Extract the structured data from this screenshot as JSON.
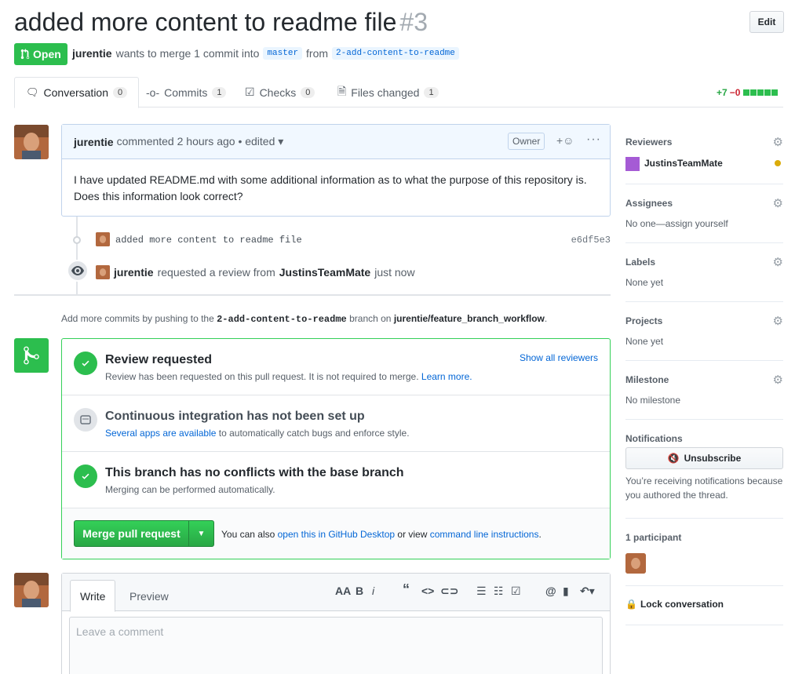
{
  "header": {
    "title": "added more content to readme file",
    "number": "#3",
    "edit_label": "Edit",
    "state": "Open",
    "author": "jurentie",
    "meta_mid": "wants to merge 1 commit into",
    "base_branch": "master",
    "meta_from": "from",
    "head_branch": "2-add-content-to-readme"
  },
  "tabs": [
    {
      "label": "Conversation",
      "count": "0"
    },
    {
      "label": "Commits",
      "count": "1"
    },
    {
      "label": "Checks",
      "count": "0"
    },
    {
      "label": "Files changed",
      "count": "1"
    }
  ],
  "diffstat": {
    "additions": "+7",
    "deletions": "−0"
  },
  "comment": {
    "author": "jurentie",
    "action": "commented 2 hours ago • edited ▾",
    "owner_badge": "Owner",
    "body": "I have updated README.md with some additional information as to what the purpose of this repository is. Does this information look correct?"
  },
  "timeline": {
    "commit_message": "added more content to readme file",
    "commit_sha": "e6df5e3",
    "review_actor": "jurentie",
    "review_text": "requested a review from",
    "review_target": "JustinsTeamMate",
    "review_time": "just now"
  },
  "push_note": {
    "prefix": "Add more commits by pushing to the",
    "branch": "2-add-content-to-readme",
    "mid": "branch on",
    "repo": "jurentie/feature_branch_workflow",
    "suffix": "."
  },
  "merge": {
    "review_title": "Review requested",
    "review_sub": "Review has been requested on this pull request. It is not required to merge.",
    "learn_more": "Learn more.",
    "show_reviewers": "Show all reviewers",
    "ci_title": "Continuous integration has not been set up",
    "ci_link": "Several apps are available",
    "ci_sub": "to automatically catch bugs and enforce style.",
    "conflict_title": "This branch has no conflicts with the base branch",
    "conflict_sub": "Merging can be performed automatically.",
    "merge_button": "Merge pull request",
    "note_prefix": "You can also",
    "note_link1": "open this in GitHub Desktop",
    "note_mid": "or view",
    "note_link2": "command line instructions",
    "note_suffix": "."
  },
  "composer": {
    "tab_write": "Write",
    "tab_preview": "Preview",
    "placeholder": "Leave a comment"
  },
  "sidebar": {
    "reviewers_label": "Reviewers",
    "reviewer_name": "JustinsTeamMate",
    "assignees_label": "Assignees",
    "assignees_value": "No one—assign yourself",
    "labels_label": "Labels",
    "labels_value": "None yet",
    "projects_label": "Projects",
    "projects_value": "None yet",
    "milestone_label": "Milestone",
    "milestone_value": "No milestone",
    "notifications_label": "Notifications",
    "unsubscribe_label": "Unsubscribe",
    "notifications_text": "You’re receiving notifications because you authored the thread.",
    "participants_label": "1 participant",
    "lock_label": "Lock conversation"
  },
  "colors": {
    "open_green": "#2cbe4e",
    "link_blue": "#0366d6",
    "pending_dot": "#dbab09"
  }
}
